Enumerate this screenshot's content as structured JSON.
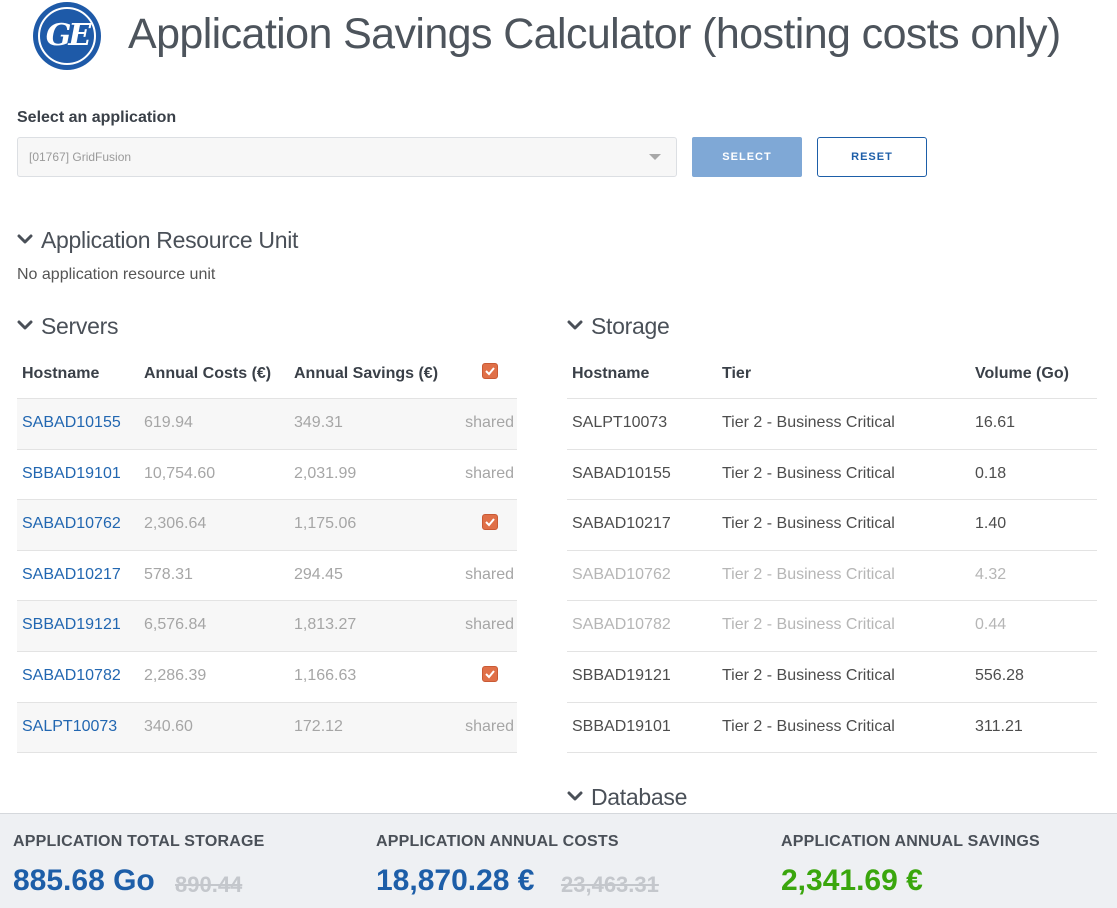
{
  "app": {
    "logo_text": "GE",
    "title": "Application Savings Calculator (hosting costs only)"
  },
  "colors": {
    "brand_blue": "#1d5ea8",
    "select_button": "#7fa8d6",
    "checkbox_orange": "#e07048",
    "savings_green": "#3aa60d",
    "footer_bg": "#eef0f3"
  },
  "selector": {
    "label": "Select an application",
    "value": "[01767] GridFusion",
    "select_button": "SELECT",
    "reset_button": "RESET"
  },
  "aru": {
    "title": "Application Resource Unit",
    "empty_message": "No application resource unit"
  },
  "servers": {
    "title": "Servers",
    "columns": [
      "Hostname",
      "Annual Costs (€)",
      "Annual Savings (€)"
    ],
    "header_checked": true,
    "rows": [
      {
        "hostname": "SABAD10155",
        "annual_costs": "619.94",
        "annual_savings": "349.31",
        "status": "shared"
      },
      {
        "hostname": "SBBAD19101",
        "annual_costs": "10,754.60",
        "annual_savings": "2,031.99",
        "status": "shared"
      },
      {
        "hostname": "SABAD10762",
        "annual_costs": "2,306.64",
        "annual_savings": "1,175.06",
        "status": "checked"
      },
      {
        "hostname": "SABAD10217",
        "annual_costs": "578.31",
        "annual_savings": "294.45",
        "status": "shared"
      },
      {
        "hostname": "SBBAD19121",
        "annual_costs": "6,576.84",
        "annual_savings": "1,813.27",
        "status": "shared"
      },
      {
        "hostname": "SABAD10782",
        "annual_costs": "2,286.39",
        "annual_savings": "1,166.63",
        "status": "checked"
      },
      {
        "hostname": "SALPT10073",
        "annual_costs": "340.60",
        "annual_savings": "172.12",
        "status": "shared"
      }
    ]
  },
  "storage": {
    "title": "Storage",
    "columns": [
      "Hostname",
      "Tier",
      "Volume (Go)"
    ],
    "rows": [
      {
        "hostname": "SALPT10073",
        "tier": "Tier 2 - Business Critical",
        "volume": "16.61",
        "active": true
      },
      {
        "hostname": "SABAD10155",
        "tier": "Tier 2 - Business Critical",
        "volume": "0.18",
        "active": true
      },
      {
        "hostname": "SABAD10217",
        "tier": "Tier 2 - Business Critical",
        "volume": "1.40",
        "active": true
      },
      {
        "hostname": "SABAD10762",
        "tier": "Tier 2 - Business Critical",
        "volume": "4.32",
        "active": false
      },
      {
        "hostname": "SABAD10782",
        "tier": "Tier 2 - Business Critical",
        "volume": "0.44",
        "active": false
      },
      {
        "hostname": "SBBAD19121",
        "tier": "Tier 2 - Business Critical",
        "volume": "556.28",
        "active": true
      },
      {
        "hostname": "SBBAD19101",
        "tier": "Tier 2 - Business Critical",
        "volume": "311.21",
        "active": true
      }
    ]
  },
  "database": {
    "title": "Database"
  },
  "footer": {
    "storage_label": "APPLICATION TOTAL STORAGE",
    "storage_value": "885.68 Go",
    "storage_old": "890.44",
    "costs_label": "APPLICATION ANNUAL COSTS",
    "costs_value": "18,870.28 €",
    "costs_old": "23,463.31",
    "savings_label": "APPLICATION ANNUAL SAVINGS",
    "savings_value": "2,341.69 €"
  }
}
